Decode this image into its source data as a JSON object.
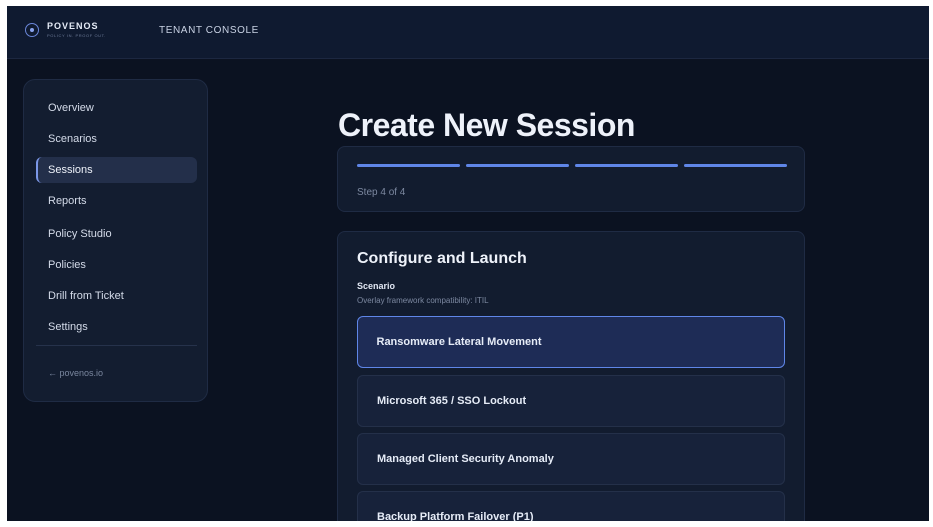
{
  "brand": {
    "name": "POVENOS",
    "tagline": "POLICY IN. PROOF OUT.",
    "logo_icon": "circle-target-icon"
  },
  "console_title": "TENANT CONSOLE",
  "sidebar": {
    "items": [
      {
        "label": "Overview",
        "active": false
      },
      {
        "label": "Scenarios",
        "active": false
      },
      {
        "label": "Sessions",
        "active": true
      },
      {
        "label": "Reports",
        "active": false
      },
      {
        "label": "Policy Studio",
        "active": false
      },
      {
        "label": "Policies",
        "active": false
      },
      {
        "label": "Drill from Ticket",
        "active": false
      },
      {
        "label": "Settings",
        "active": false
      }
    ],
    "footer_link": "← povenos.io"
  },
  "main": {
    "title": "Create New Session",
    "progress": {
      "steps_total": 4,
      "steps_complete": 4,
      "step_text": "Step 4 of 4"
    },
    "config": {
      "title": "Configure and Launch",
      "field_label": "Scenario",
      "field_help": "Overlay framework compatibility: ITIL",
      "options": [
        {
          "label": "Ransomware Lateral Movement",
          "selected": true
        },
        {
          "label": "Microsoft 365 / SSO Lockout",
          "selected": false
        },
        {
          "label": "Managed Client Security Anomaly",
          "selected": false
        },
        {
          "label": "Backup Platform Failover (P1)",
          "selected": false
        }
      ]
    }
  },
  "colors": {
    "accent": "#5f86e8",
    "background": "#0b1221",
    "card": "#121c2f"
  }
}
